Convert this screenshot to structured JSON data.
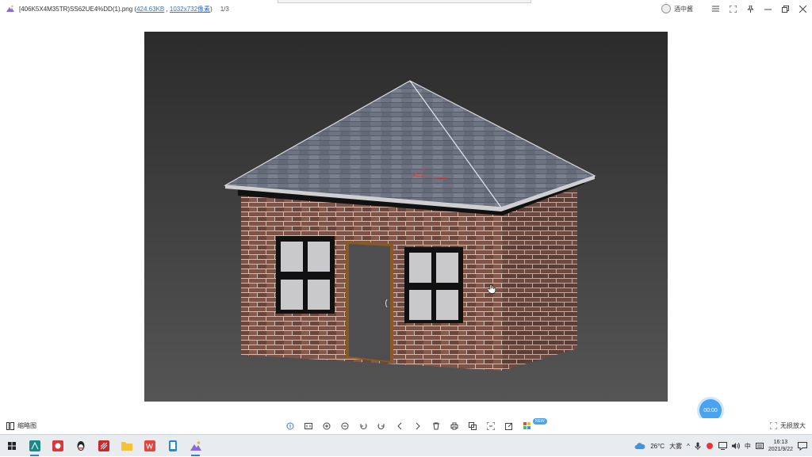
{
  "titlebar": {
    "filename": "[406K5X4M35TR)SS62UE4%DD(1).png",
    "size": "424.63KB",
    "dimensions": "1032x732像素",
    "page": "1/3",
    "user": "酒中酱"
  },
  "viewer": {
    "timer": "00:00"
  },
  "toolbar": {
    "thumbnail_label": "缩略图",
    "new_badge": "NEW",
    "lossless_label": "无损放大"
  },
  "taskbar": {
    "weather_temp": "26°C",
    "weather_desc": "大雾",
    "ime": "中",
    "time": "16:13",
    "date": "2021/9/22"
  },
  "colors": {
    "accent": "#4aa3f0",
    "link": "#3a6fd0",
    "taskbar": "#e9ecef"
  }
}
